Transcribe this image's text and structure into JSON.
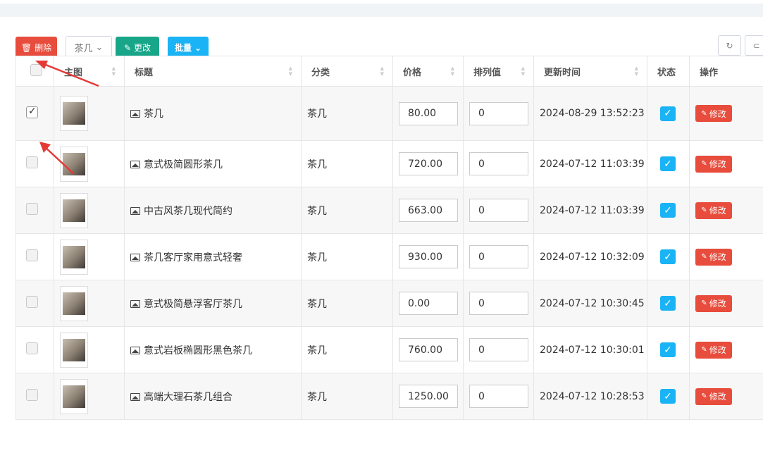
{
  "toolbar": {
    "delete_label": "删除",
    "category_label": "茶几",
    "edit_label": "更改",
    "batch_label": "批量"
  },
  "table": {
    "headers": [
      "主图",
      "标题",
      "分类",
      "价格",
      "排列值",
      "更新时间",
      "状态",
      "操作"
    ],
    "rows": [
      {
        "title": "茶几",
        "category": "茶几",
        "price": "80.00",
        "sort": "0",
        "updated": "2024-08-29 13:52:23",
        "checked": true,
        "action": "修改"
      },
      {
        "title": "意式极简圆形茶几",
        "category": "茶几",
        "price": "720.00",
        "sort": "0",
        "updated": "2024-07-12 11:03:39",
        "checked": false,
        "action": "修改"
      },
      {
        "title": "中古风茶几现代简约",
        "category": "茶几",
        "price": "663.00",
        "sort": "0",
        "updated": "2024-07-12 11:03:39",
        "checked": false,
        "action": "修改"
      },
      {
        "title": "茶几客厅家用意式轻奢",
        "category": "茶几",
        "price": "930.00",
        "sort": "0",
        "updated": "2024-07-12 10:32:09",
        "checked": false,
        "action": "修改"
      },
      {
        "title": "意式极简悬浮客厅茶几",
        "category": "茶几",
        "price": "0.00",
        "sort": "0",
        "updated": "2024-07-12 10:30:45",
        "checked": false,
        "action": "修改"
      },
      {
        "title": "意式岩板椭圆形黑色茶几",
        "category": "茶几",
        "price": "760.00",
        "sort": "0",
        "updated": "2024-07-12 10:30:01",
        "checked": false,
        "action": "修改"
      },
      {
        "title": "高端大理石茶几组合",
        "category": "茶几",
        "price": "1250.00",
        "sort": "0",
        "updated": "2024-07-12 10:28:53",
        "checked": false,
        "action": "修改"
      }
    ]
  },
  "colors": {
    "danger": "#e74c3c",
    "success": "#18a689",
    "info": "#1ab3f5",
    "annotation_arrow": "#e53935"
  },
  "icons": {
    "delete": "trash-icon",
    "edit": "edit-icon",
    "refresh": "refresh-icon",
    "toggle": "toggle-icon",
    "title": "image-icon",
    "status": "check-icon"
  }
}
